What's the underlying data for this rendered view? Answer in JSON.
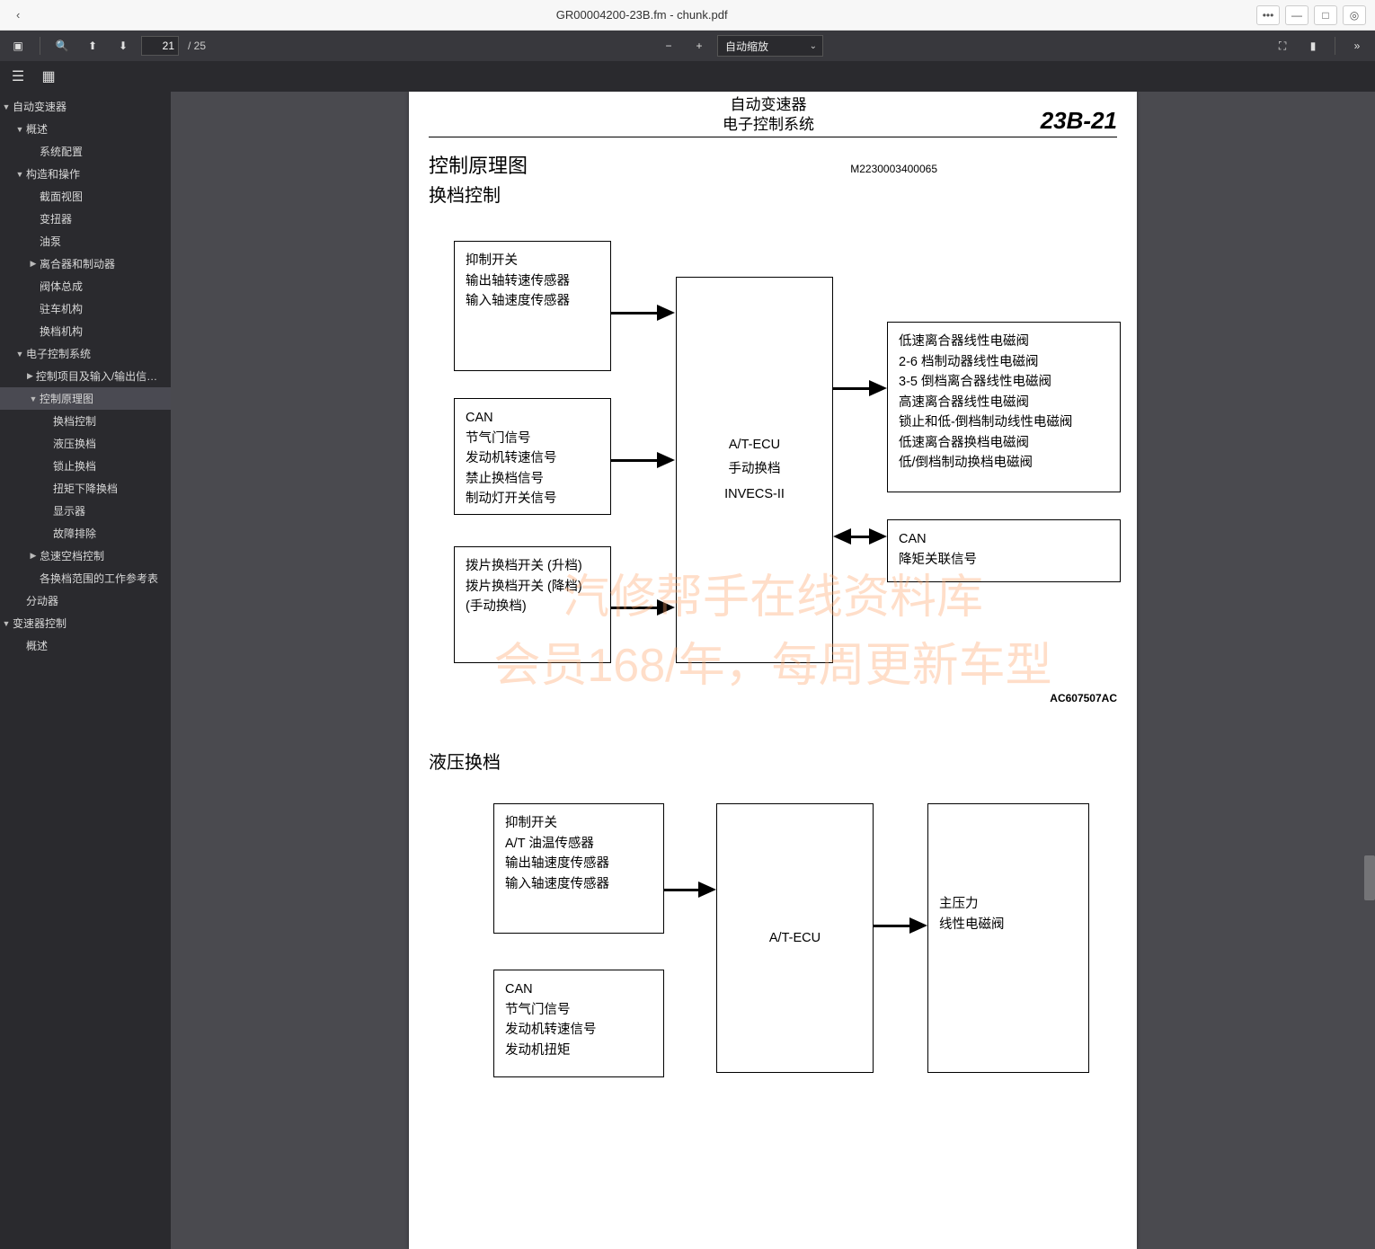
{
  "titlebar": {
    "title": "GR00004200-23B.fm - chunk.pdf"
  },
  "toolbar": {
    "page_current": "21",
    "page_total": "/ 25",
    "zoom_label": "自动缩放"
  },
  "outline": [
    {
      "ind": 1,
      "exp": "down",
      "label": "自动变速器"
    },
    {
      "ind": 2,
      "exp": "down",
      "label": "概述"
    },
    {
      "ind": 3,
      "exp": "leaf",
      "label": "系统配置"
    },
    {
      "ind": 2,
      "exp": "down",
      "label": "构造和操作"
    },
    {
      "ind": 3,
      "exp": "leaf",
      "label": "截面视图"
    },
    {
      "ind": 3,
      "exp": "leaf",
      "label": "变扭器"
    },
    {
      "ind": 3,
      "exp": "leaf",
      "label": "油泵"
    },
    {
      "ind": 3,
      "exp": "right",
      "label": "离合器和制动器"
    },
    {
      "ind": 3,
      "exp": "leaf",
      "label": "阀体总成"
    },
    {
      "ind": 3,
      "exp": "leaf",
      "label": "驻车机构"
    },
    {
      "ind": 3,
      "exp": "leaf",
      "label": "换档机构"
    },
    {
      "ind": 2,
      "exp": "down",
      "label": "电子控制系统"
    },
    {
      "ind": 3,
      "exp": "right",
      "label": "控制项目及输入/输出信号列表"
    },
    {
      "ind": 3,
      "exp": "down",
      "label": "控制原理图",
      "selected": true
    },
    {
      "ind": 4,
      "exp": "leaf",
      "label": "换档控制"
    },
    {
      "ind": 4,
      "exp": "leaf",
      "label": "液压换档"
    },
    {
      "ind": 4,
      "exp": "leaf",
      "label": "锁止换档"
    },
    {
      "ind": 4,
      "exp": "leaf",
      "label": "扭矩下降换档"
    },
    {
      "ind": 4,
      "exp": "leaf",
      "label": "显示器"
    },
    {
      "ind": 4,
      "exp": "leaf",
      "label": "故障排除"
    },
    {
      "ind": 3,
      "exp": "right",
      "label": "怠速空档控制"
    },
    {
      "ind": 3,
      "exp": "leaf",
      "label": "各换档范围的工作参考表"
    },
    {
      "ind": 2,
      "exp": "leaf",
      "label": "分动器"
    },
    {
      "ind": 1,
      "exp": "down",
      "label": "变速器控制"
    },
    {
      "ind": 2,
      "exp": "leaf",
      "label": "概述"
    }
  ],
  "page": {
    "hdr1": "自动变速器",
    "hdr2": "电子控制系统",
    "hdr_right": "23B-21",
    "title1": "控制原理图",
    "doc_code": "M2230003400065",
    "section1": "换档控制",
    "section2": "液压换档",
    "fig_code": "AC607507AC",
    "diagram1": {
      "box1": [
        "抑制开关",
        "输出轴转速传感器",
        "输入轴速度传感器"
      ],
      "box2": [
        "CAN",
        "节气门信号",
        "发动机转速信号",
        "禁止换档信号",
        "制动灯开关信号"
      ],
      "box3": [
        "拨片换档开关 (升档)",
        "拨片换档开关 (降档)",
        "(手动换档)"
      ],
      "ecu": [
        "A/T-ECU",
        "手动换档",
        "INVECS-II"
      ],
      "box4": [
        "低速离合器线性电磁阀",
        "2-6 档制动器线性电磁阀",
        "3-5 倒档离合器线性电磁阀",
        "高速离合器线性电磁阀",
        "锁止和低-倒档制动线性电磁阀",
        "低速离合器换档电磁阀",
        "低/倒档制动换档电磁阀"
      ],
      "box5": [
        "CAN",
        "降矩关联信号"
      ]
    },
    "diagram2": {
      "box1": [
        "抑制开关",
        "A/T 油温传感器",
        "输出轴速度传感器",
        "输入轴速度传感器"
      ],
      "box2": [
        "CAN",
        "节气门信号",
        "发动机转速信号",
        "发动机扭矩"
      ],
      "ecu": [
        "A/T-ECU"
      ],
      "box3": [
        "主压力",
        "线性电磁阀"
      ]
    }
  },
  "watermark": {
    "line1": "汽修帮手在线资料库",
    "line2": "会员168/年，每周更新车型"
  }
}
